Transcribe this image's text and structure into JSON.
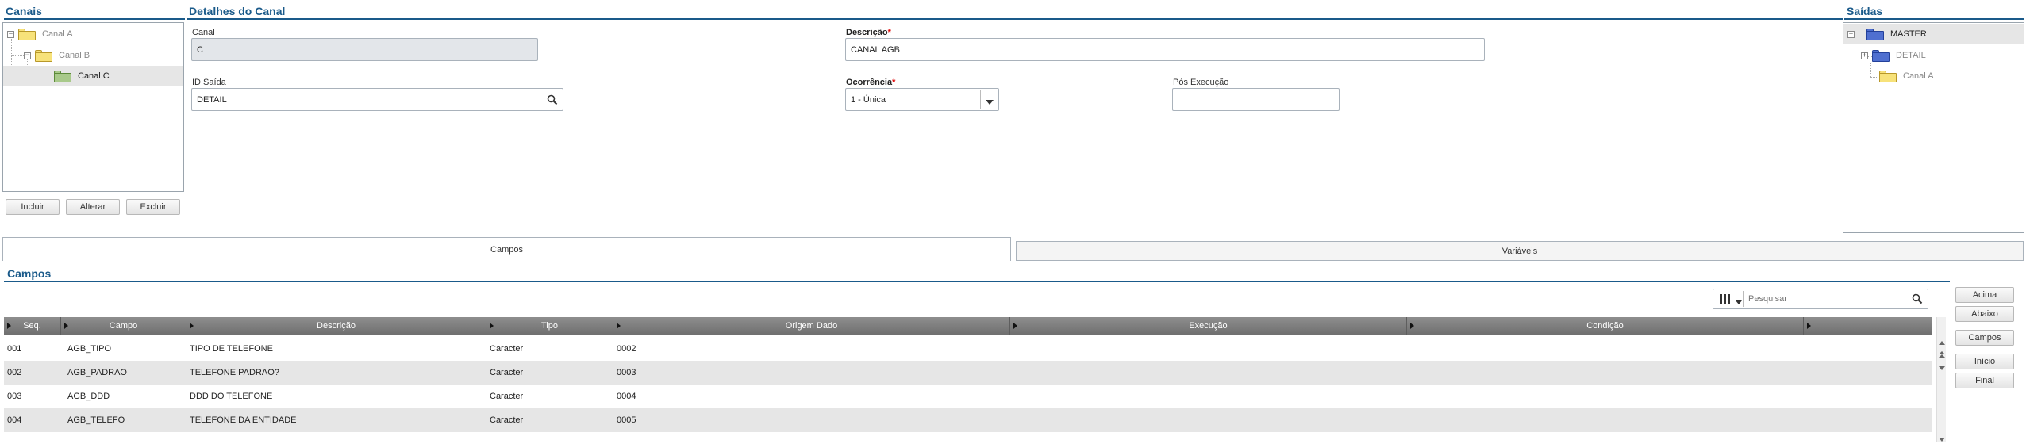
{
  "canais": {
    "title": "Canais",
    "tree": [
      {
        "label": "Canal A",
        "level": 0,
        "toggle": "−"
      },
      {
        "label": "Canal B",
        "level": 1,
        "toggle": "−"
      },
      {
        "label": "Canal C",
        "level": 2,
        "selected": true
      }
    ],
    "buttons": {
      "incluir": "Incluir",
      "alterar": "Alterar",
      "excluir": "Excluir"
    }
  },
  "detalhes": {
    "title": "Detalhes do Canal",
    "canal_label": "Canal",
    "canal_value": "C",
    "descricao_label": "Descrição",
    "descricao_value": "CANAL AGB",
    "id_saida_label": "ID Saída",
    "id_saida_value": "DETAIL",
    "ocorrencia_label": "Ocorrência",
    "ocorrencia_value": "1 - Única",
    "pos_execucao_label": "Pós Execução",
    "pos_execucao_value": "",
    "required_mark": "*"
  },
  "saidas": {
    "title": "Saídas",
    "tree": [
      {
        "label": "MASTER",
        "toggle": "−"
      },
      {
        "label": "DETAIL",
        "toggle": "+"
      },
      {
        "label": "Canal A"
      }
    ]
  },
  "tabs": {
    "campos": "Campos",
    "variaveis": "Variáveis"
  },
  "campos": {
    "title": "Campos",
    "search_placeholder": "Pesquisar",
    "columns": [
      "Seq.",
      "Campo",
      "Descrição",
      "Tipo",
      "Origem Dado",
      "Execução",
      "Condição",
      ""
    ],
    "rows": [
      [
        "001",
        "AGB_TIPO",
        "TIPO DE TELEFONE",
        "Caracter",
        "0002",
        "",
        ""
      ],
      [
        "002",
        "AGB_PADRAO",
        "TELEFONE PADRAO?",
        "Caracter",
        "0003",
        "",
        ""
      ],
      [
        "003",
        "AGB_DDD",
        "DDD DO TELEFONE",
        "Caracter",
        "0004",
        "",
        ""
      ],
      [
        "004",
        "AGB_TELEFO",
        "TELEFONE DA ENTIDADE",
        "Caracter",
        "0005",
        "",
        ""
      ]
    ],
    "side_buttons": {
      "acima": "Acima",
      "abaixo": "Abaixo",
      "campos": "Campos",
      "inicio": "Início",
      "final": "Final"
    }
  },
  "colors": {
    "accent": "#1a5a8a",
    "header_bg": "#7a7a7a",
    "row_alt": "#e6e6e6"
  }
}
